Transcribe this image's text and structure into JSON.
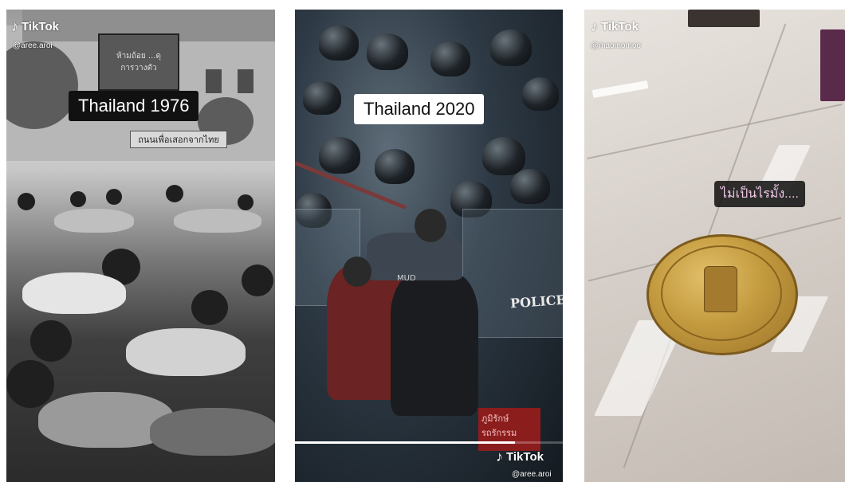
{
  "panels": [
    {
      "watermark": {
        "logo_label": "TikTok",
        "icon": "tiktok-note-icon",
        "handle": "@aree.aroi"
      },
      "caption": "Thailand 1976",
      "signboard_text": "ห้ามถ้อย ...ดุ\nการวางตัว",
      "banner_text": "ถนนเพื่อเสอกจากไทย"
    },
    {
      "watermark": {
        "logo_label": "TikTok",
        "icon": "tiktok-note-icon",
        "handle": "@aree.aroi"
      },
      "caption": "Thailand 2020",
      "shield_text": "POLICE",
      "helmet_text": "MUD",
      "sign_text": "ภูมิรักษ์\nรถรักรรม",
      "progress": 0.82
    },
    {
      "watermark": {
        "logo_label": "TikTok",
        "icon": "tiktok-note-icon",
        "handle": "@maomomoo"
      },
      "caption": "ไม่เป็นไรมั้ง...."
    }
  ],
  "colors": {
    "caption_dark_bg": "#111111",
    "caption_light_bg": "#ffffff",
    "caption_thai_text": "#f0c7e6",
    "medallion_gold": "#c39a3e"
  }
}
